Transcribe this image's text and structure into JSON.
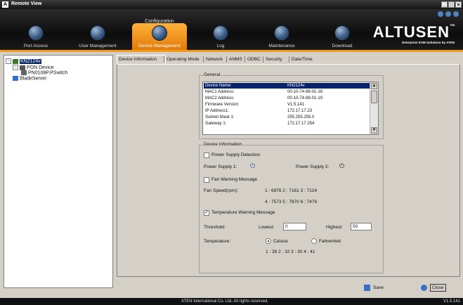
{
  "window": {
    "title": "Remote View",
    "min": "_",
    "max": "□",
    "close": "×"
  },
  "header": {
    "config_label": "Configuration",
    "nav": [
      {
        "label": "Port Access",
        "icon": "port-access-icon"
      },
      {
        "label": "User Management",
        "icon": "user-management-icon"
      },
      {
        "label": "Device Management",
        "icon": "device-management-icon",
        "active": true
      },
      {
        "label": "Log",
        "icon": "log-icon"
      },
      {
        "label": "Maintenance",
        "icon": "maintenance-icon"
      },
      {
        "label": "Download",
        "icon": "download-icon"
      }
    ],
    "brand": "ALTUSEN",
    "brand_tm": "™",
    "brand_sub": "Enterprise KVM Solutions by ATEN"
  },
  "tree": {
    "root": "KN2124v",
    "pon": "PON Device",
    "pon_child": "PN0108P.PSwitch",
    "blade": "BladeServer"
  },
  "tabs": [
    "Device Information",
    "Operating Mode",
    "Network",
    "ANMS",
    "ODBC",
    "Security",
    "Date/Time"
  ],
  "general": {
    "legend": "General",
    "rows": [
      {
        "k": "Device Name:",
        "v": "KN2124v"
      },
      {
        "k": "MAC1 Address:",
        "v": "00-10-74-98-01-18"
      },
      {
        "k": "MAC2 Address:",
        "v": "00-10-74-98-01-19"
      },
      {
        "k": "Firmware Version:",
        "v": "V1.5.141"
      },
      {
        "k": "IP Address1:",
        "v": "172.17.17.23"
      },
      {
        "k": "Subnet Mask 1:",
        "v": "255.255.255.0"
      },
      {
        "k": "Gateway 1:",
        "v": "172.17.17.254"
      }
    ]
  },
  "devinfo": {
    "legend": "Device Information",
    "power_detect": "Power Supply Detection",
    "ps1": "Power Supply 1:",
    "ps2": "Power Supply 2:",
    "fan_warn": "Fan Warning Message",
    "fan_speed": "Fan Speed(rpm):",
    "fan_row1": "1 : 6976  2 : 7161  3 : 7124",
    "fan_row2": "4 : 7573  5 : 7670  6 : 7479",
    "temp_warn": "Temperature Warning Message",
    "threshold": "Threshold:",
    "lowest": "Lowest:",
    "lowest_val": "0",
    "highest": "Highest:",
    "highest_val": "50",
    "temperature": "Temperature:",
    "celsius": "Celsius",
    "fahrenheit": "Fahrenheit",
    "temp_values": "1 :  38   2 :  32   3 :  30   4 :  41"
  },
  "footer": {
    "save": "Save",
    "close": "Close",
    "copyright": "ATEN International Co. Ltd. All rights reserved.",
    "version": "V1.5.141"
  }
}
